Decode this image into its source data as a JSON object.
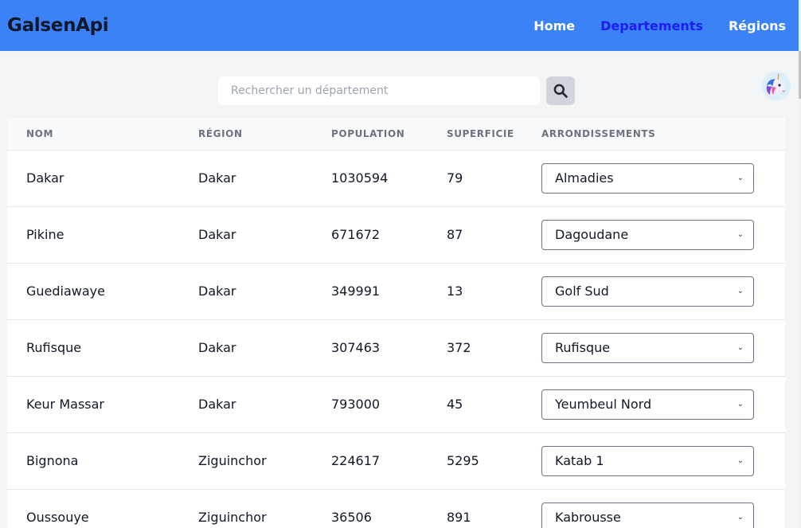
{
  "brand": "GalsenApi",
  "nav": [
    {
      "label": "Home",
      "active": false
    },
    {
      "label": "Departements",
      "active": true
    },
    {
      "label": "Régions",
      "active": false
    }
  ],
  "search": {
    "placeholder": "Rechercher un département",
    "value": "",
    "icon": "search-icon"
  },
  "avatar": {
    "icon": "unicorn-avatar"
  },
  "table": {
    "headers": [
      "NOM",
      "RÉGION",
      "POPULATION",
      "SUPERFICIE",
      "ARRONDISSEMENTS"
    ],
    "rows": [
      {
        "nom": "Dakar",
        "region": "Dakar",
        "population": "1030594",
        "superficie": "79",
        "arrondissement": "Almadies"
      },
      {
        "nom": "Pikine",
        "region": "Dakar",
        "population": "671672",
        "superficie": "87",
        "arrondissement": "Dagoudane"
      },
      {
        "nom": "Guediawaye",
        "region": "Dakar",
        "population": "349991",
        "superficie": "13",
        "arrondissement": "Golf Sud"
      },
      {
        "nom": "Rufisque",
        "region": "Dakar",
        "population": "307463",
        "superficie": "372",
        "arrondissement": "Rufisque"
      },
      {
        "nom": "Keur Massar",
        "region": "Dakar",
        "population": "793000",
        "superficie": "45",
        "arrondissement": "Yeumbeul Nord"
      },
      {
        "nom": "Bignona",
        "region": "Ziguinchor",
        "population": "224617",
        "superficie": "5295",
        "arrondissement": "Katab 1"
      },
      {
        "nom": "Oussouye",
        "region": "Ziguinchor",
        "population": "36506",
        "superficie": "891",
        "arrondissement": "Kabrousse"
      }
    ]
  },
  "colors": {
    "navbar": "#3b82f6",
    "active_link": "#1d1df0",
    "page_bg": "#f3f4f6"
  }
}
